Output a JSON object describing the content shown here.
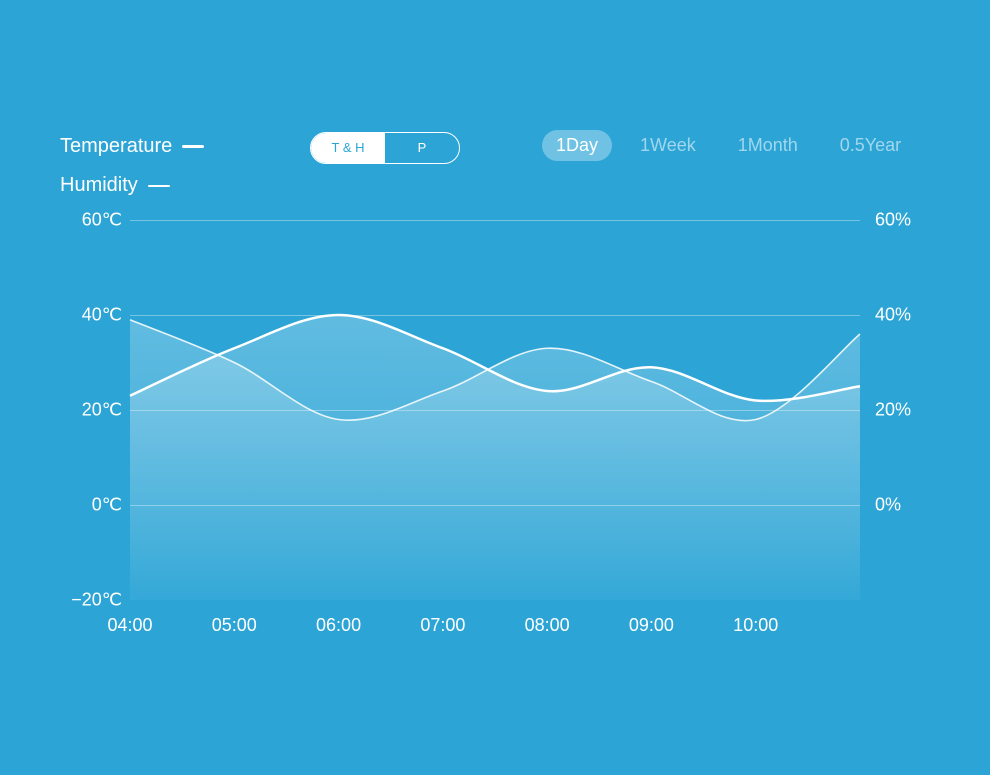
{
  "legend": {
    "temperature": "Temperature",
    "humidity": "Humidity"
  },
  "mode": {
    "th": "T & H",
    "p": "P",
    "active": "th"
  },
  "ranges": {
    "items": [
      "1Day",
      "1Week",
      "1Month",
      "0.5Year"
    ],
    "active": 0
  },
  "chart_data": {
    "type": "line",
    "title": "",
    "x": [
      "04:00",
      "05:00",
      "06:00",
      "07:00",
      "08:00",
      "09:00",
      "10:00"
    ],
    "left_axis": {
      "label": "Temperature",
      "unit": "℃",
      "ticks": [
        -20,
        0,
        20,
        40,
        60
      ],
      "range": [
        -20,
        60
      ]
    },
    "right_axis": {
      "label": "Humidity",
      "unit": "%",
      "ticks": [
        0,
        20,
        40,
        60
      ],
      "range": [
        -20,
        60
      ]
    },
    "series": [
      {
        "name": "Temperature",
        "axis": "left",
        "values": [
          23,
          33,
          40,
          33,
          24,
          29,
          22,
          25
        ]
      },
      {
        "name": "Humidity",
        "axis": "right",
        "values": [
          39,
          30,
          18,
          24,
          33,
          26,
          18,
          36
        ]
      }
    ],
    "grid": true,
    "legend_position": "top-left"
  }
}
